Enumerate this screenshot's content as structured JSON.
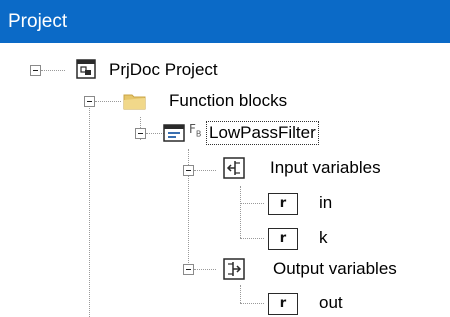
{
  "panel": {
    "title": "Project"
  },
  "tree": {
    "root": {
      "label": "PrjDoc Project"
    },
    "folder": {
      "label": "Function blocks"
    },
    "block": {
      "label": "LowPassFilter",
      "badge": "F",
      "badge_sub": "B"
    },
    "inputs": {
      "label": "Input variables",
      "items": [
        {
          "type_glyph": "r",
          "label": "in"
        },
        {
          "type_glyph": "r",
          "label": "k"
        }
      ]
    },
    "outputs": {
      "label": "Output variables",
      "items": [
        {
          "type_glyph": "r",
          "label": "out"
        }
      ]
    }
  },
  "colors": {
    "title_bar": "#0b6ac7",
    "folder": "#e6c66a",
    "selection_outline": "#333333"
  }
}
